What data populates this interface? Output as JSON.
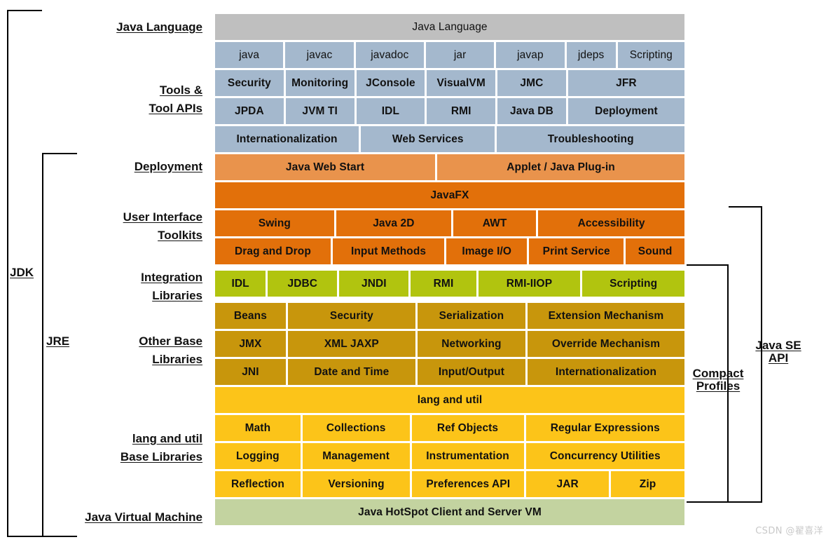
{
  "colors": {
    "java_language": "#bfbfbf",
    "tools": "#a4b8cd",
    "deployment": "#e9934c",
    "user_interface": "#e2700a",
    "integration": "#b1c40f",
    "other_base": "#c8960c",
    "lang_and_util": "#fcc419",
    "jvm": "#c3d3a0",
    "bracket": "#000000",
    "text": "#111111",
    "watermark": "#c9c9c9"
  },
  "left_labels": {
    "java_language": "Java Language",
    "tools_and_tool_apis": "Tools &\nTool APIs",
    "deployment": "Deployment",
    "user_interface_toolkits": "User Interface\nToolkits",
    "integration_libraries": "Integration\nLibraries",
    "other_base_libraries": "Other Base\nLibraries",
    "lang_and_util_base_libraries": "lang and util\nBase Libraries",
    "java_virtual_machine": "Java Virtual Machine"
  },
  "brackets": {
    "jdk": "JDK",
    "jre": "JRE",
    "compact_profiles": "Compact\nProfiles",
    "java_se_api": "Java SE\nAPI"
  },
  "bands": {
    "java_language": {
      "name": "Java Language",
      "rows": [
        [
          {
            "label": "Java Language",
            "flex": 1
          }
        ]
      ]
    },
    "tools": {
      "name": "Tools & Tool APIs",
      "rows": [
        [
          {
            "label": "java",
            "flex": 1
          },
          {
            "label": "javac",
            "flex": 1
          },
          {
            "label": "javadoc",
            "flex": 1
          },
          {
            "label": "jar",
            "flex": 1
          },
          {
            "label": "javap",
            "flex": 1
          },
          {
            "label": "jdeps",
            "flex": 0.72
          },
          {
            "label": "Scripting",
            "flex": 0.98
          }
        ],
        [
          {
            "label": "Security",
            "flex": 1
          },
          {
            "label": "Monitoring",
            "flex": 1
          },
          {
            "label": "JConsole",
            "flex": 1
          },
          {
            "label": "VisualVM",
            "flex": 1
          },
          {
            "label": "JMC",
            "flex": 1
          },
          {
            "label": "JFR",
            "flex": 1.7
          }
        ],
        [
          {
            "label": "JPDA",
            "flex": 1
          },
          {
            "label": "JVM TI",
            "flex": 1
          },
          {
            "label": "IDL",
            "flex": 1
          },
          {
            "label": "RMI",
            "flex": 1
          },
          {
            "label": "Java DB",
            "flex": 1
          },
          {
            "label": "Deployment",
            "flex": 1.7
          }
        ],
        [
          {
            "label": "Internationalization",
            "flex": 2.07
          },
          {
            "label": "Web Services",
            "flex": 1.93
          },
          {
            "label": "Troubleshooting",
            "flex": 2.7
          }
        ]
      ]
    },
    "deployment": {
      "name": "Deployment",
      "rows": [
        [
          {
            "label": "Java Web Start",
            "flex": 1.05
          },
          {
            "label": "Applet / Java Plug-in",
            "flex": 1.18
          }
        ]
      ]
    },
    "user_interface": {
      "name": "User Interface Toolkits",
      "rows": [
        [
          {
            "label": "JavaFX",
            "flex": 1
          }
        ],
        [
          {
            "label": "Swing",
            "flex": 1.22
          },
          {
            "label": "Java 2D",
            "flex": 1.18
          },
          {
            "label": "AWT",
            "flex": 0.85
          },
          {
            "label": "Accessibility",
            "flex": 1.5
          }
        ],
        [
          {
            "label": "Drag and Drop",
            "flex": 1.22
          },
          {
            "label": "Input Methods",
            "flex": 1.18
          },
          {
            "label": "Image I/O",
            "flex": 0.85
          },
          {
            "label": "Print Service",
            "flex": 1.0
          },
          {
            "label": "Sound",
            "flex": 0.62
          }
        ]
      ]
    },
    "integration": {
      "name": "Integration Libraries",
      "rows": [
        [
          {
            "label": "IDL",
            "flex": 0.62
          },
          {
            "label": "JDBC",
            "flex": 0.85
          },
          {
            "label": "JNDI",
            "flex": 0.85
          },
          {
            "label": "RMI",
            "flex": 0.8
          },
          {
            "label": "RMI-IIOP",
            "flex": 1.25
          },
          {
            "label": "Scripting",
            "flex": 1.25
          }
        ]
      ]
    },
    "other_base": {
      "name": "Other Base Libraries",
      "rows": [
        [
          {
            "label": "Beans",
            "flex": 0.72
          },
          {
            "label": "Security",
            "flex": 1.3
          },
          {
            "label": "Serialization",
            "flex": 1.1
          },
          {
            "label": "Extension Mechanism",
            "flex": 1.6
          }
        ],
        [
          {
            "label": "JMX",
            "flex": 0.72
          },
          {
            "label": "XML JAXP",
            "flex": 1.3
          },
          {
            "label": "Networking",
            "flex": 1.1
          },
          {
            "label": "Override Mechanism",
            "flex": 1.6
          }
        ],
        [
          {
            "label": "JNI",
            "flex": 0.72
          },
          {
            "label": "Date and Time",
            "flex": 1.3
          },
          {
            "label": "Input/Output",
            "flex": 1.1
          },
          {
            "label": "Internationalization",
            "flex": 1.6
          }
        ]
      ]
    },
    "lang_and_util": {
      "name": "lang and util Base Libraries",
      "rows": [
        [
          {
            "label": "lang and util",
            "flex": 1
          }
        ],
        [
          {
            "label": "Math",
            "flex": 0.86
          },
          {
            "label": "Collections",
            "flex": 1.08
          },
          {
            "label": "Ref Objects",
            "flex": 1.13
          },
          {
            "label": "Regular Expressions",
            "flex": 1.6
          }
        ],
        [
          {
            "label": "Logging",
            "flex": 0.86
          },
          {
            "label": "Management",
            "flex": 1.08
          },
          {
            "label": "Instrumentation",
            "flex": 1.13
          },
          {
            "label": "Concurrency Utilities",
            "flex": 1.6
          }
        ],
        [
          {
            "label": "Reflection",
            "flex": 0.86
          },
          {
            "label": "Versioning",
            "flex": 1.08
          },
          {
            "label": "Preferences API",
            "flex": 1.13
          },
          {
            "label": "JAR",
            "flex": 0.83
          },
          {
            "label": "Zip",
            "flex": 0.74
          }
        ]
      ]
    },
    "jvm": {
      "name": "Java Virtual Machine",
      "rows": [
        [
          {
            "label": "Java HotSpot Client and Server VM",
            "flex": 1
          }
        ]
      ]
    }
  },
  "watermark": "CSDN @翟喜洋"
}
